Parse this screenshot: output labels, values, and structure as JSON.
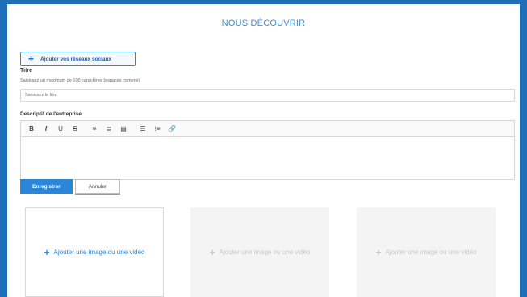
{
  "section": {
    "title": "NOUS DÉCOUVRIR"
  },
  "social": {
    "plus": "+",
    "label": "Ajouter vos réseaux sociaux"
  },
  "titre": {
    "label": "Titre",
    "help": "Saisissez un maximum de 100 caractères (espaces compris)",
    "placeholder": "Saisissez le titre"
  },
  "description": {
    "label": "Descriptif de l'entreprise",
    "toolbar": [
      {
        "name": "bold-icon",
        "glyph": "B"
      },
      {
        "name": "italic-icon",
        "glyph": "I"
      },
      {
        "name": "underline-icon",
        "glyph": "U"
      },
      {
        "name": "strikethrough-icon",
        "glyph": "S"
      },
      {
        "name": "align-left-icon",
        "glyph": "≡"
      },
      {
        "name": "align-center-icon",
        "glyph": "≣"
      },
      {
        "name": "align-justify-icon",
        "glyph": "▤"
      },
      {
        "name": "bullet-list-icon",
        "glyph": "☰"
      },
      {
        "name": "numbered-list-icon",
        "glyph": "⁝≡"
      },
      {
        "name": "link-icon",
        "glyph": "🔗"
      }
    ]
  },
  "actions": {
    "save": "Enregistrer",
    "cancel": "Annuler"
  },
  "media": [
    {
      "plus": "+",
      "label": "Ajouter une image ou une vidéo"
    },
    {
      "plus": "+",
      "label": "Ajouter une image ou une vidéo"
    },
    {
      "plus": "+",
      "label": "Ajouter une image ou une vidéo"
    }
  ],
  "colors": {
    "accent": "#2a86d9",
    "frame": "#1e6fb8"
  }
}
